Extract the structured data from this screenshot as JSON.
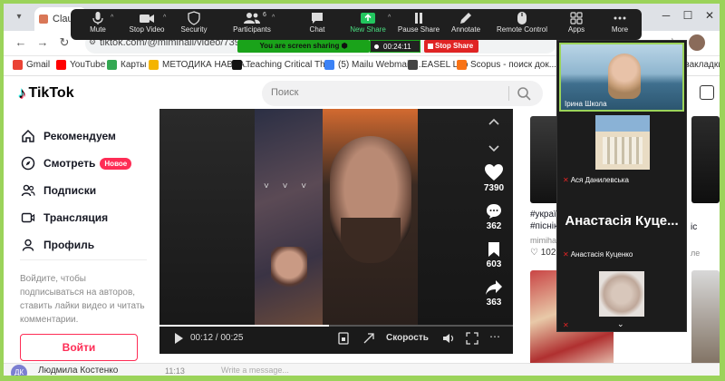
{
  "browser": {
    "tab_title": "Claude",
    "url": "tiktok.com/@mimihail/video/73963555",
    "bookmarks": [
      {
        "label": "Gmail",
        "color": "#ea4335"
      },
      {
        "label": "YouTube",
        "color": "#ff0000"
      },
      {
        "label": "Карты",
        "color": "#34a853"
      },
      {
        "label": "МЕТОДИКА НАВЧА...",
        "color": "#f4b400"
      },
      {
        "label": "Teaching Critical Thi...",
        "color": "#111111"
      },
      {
        "label": "(5) Mailu Webmail ::...",
        "color": "#3b82f6"
      },
      {
        "label": "EASEL Lab",
        "color": "#444444"
      },
      {
        "label": "Scopus - поиск док...",
        "color": "#f97316"
      }
    ],
    "bookmarks_overflow": "закладки"
  },
  "zoom": {
    "buttons": {
      "mute": "Mute",
      "stop_video": "Stop Video",
      "security": "Security",
      "participants": "Participants",
      "participants_count": "6",
      "chat": "Chat",
      "new_share": "New Share",
      "pause_share": "Pause Share",
      "annotate": "Annotate",
      "remote_control": "Remote Control",
      "apps": "Apps",
      "more": "More"
    },
    "sharing_text": "You are screen sharing",
    "timer": "00:24:11",
    "stop_share": "Stop Share",
    "participants": [
      {
        "name": "Ірина Школа",
        "muted": false
      },
      {
        "name": "Ася Данилевська",
        "muted": true
      },
      {
        "name": "Анастасія Куценко",
        "muted": true,
        "display": "Анастасія Куце..."
      },
      {
        "name": "",
        "muted": true
      }
    ]
  },
  "tiktok": {
    "logo": "TikTok",
    "search_placeholder": "Поиск",
    "nav": [
      {
        "label": "Рекомендуем",
        "icon": "home-icon"
      },
      {
        "label": "Смотреть",
        "icon": "compass-icon",
        "badge": "Новое"
      },
      {
        "label": "Подписки",
        "icon": "users-icon"
      },
      {
        "label": "Трансляция",
        "icon": "live-icon"
      },
      {
        "label": "Профиль",
        "icon": "profile-icon"
      }
    ],
    "login_hint": "Войдите, чтобы подписываться на авторов, ставить лайки видео и читать комментарии.",
    "login_button": "Войти",
    "video": {
      "likes": "7390",
      "comments": "362",
      "saves": "603",
      "shares": "363",
      "time_current": "00:12",
      "time_total": "00:25",
      "progress": 0.48,
      "speed_label": "Скорость"
    },
    "feed": {
      "caption_line1": "#україн",
      "caption_line2": "#піснію",
      "author": "mimihail",
      "likes": "102",
      "right_caption": "іс",
      "right_meta": "ле"
    }
  },
  "chat": {
    "avatar_initials": "ДК",
    "sender": "Людмила Костенко",
    "time": "11:13",
    "placeholder": "Write a message..."
  }
}
